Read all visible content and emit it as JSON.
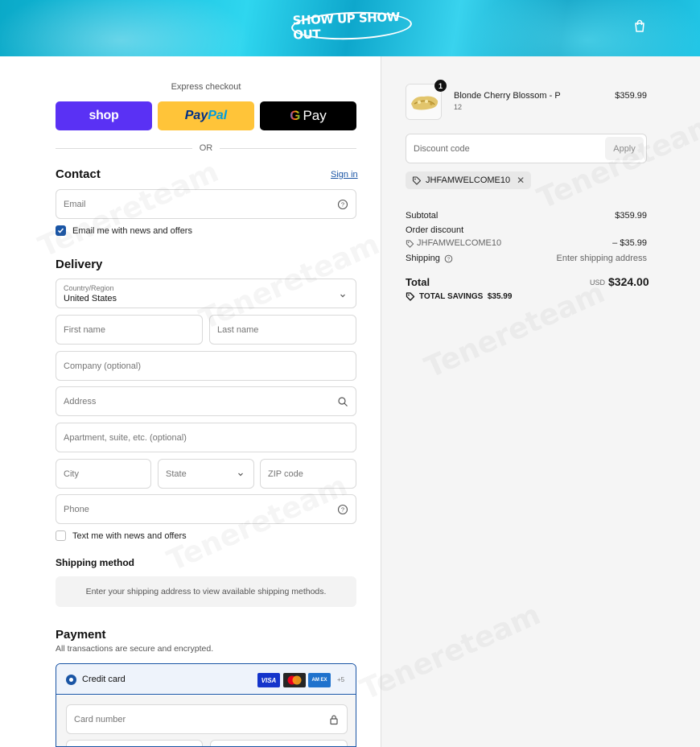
{
  "header": {
    "logo_text": "SHOW UP SHOW OUT",
    "bag_icon": "shopping-bag-icon",
    "colors": {
      "banner": "#19c1e0"
    }
  },
  "express": {
    "label": "Express checkout",
    "buttons": {
      "shop": "shop",
      "paypal_1": "Pay",
      "paypal_2": "Pal",
      "gpay_g": "G",
      "gpay_text": "Pay"
    },
    "or": "OR"
  },
  "contact": {
    "heading": "Contact",
    "signin": "Sign in",
    "email_placeholder": "Email",
    "email_news": "Email me with news and offers"
  },
  "delivery": {
    "heading": "Delivery",
    "country_label": "Country/Region",
    "country_value": "United States",
    "first_name": "First name",
    "last_name": "Last name",
    "company": "Company (optional)",
    "address": "Address",
    "apartment": "Apartment, suite, etc. (optional)",
    "city": "City",
    "state": "State",
    "zip": "ZIP code",
    "phone": "Phone",
    "text_news": "Text me with news and offers"
  },
  "shipping": {
    "heading": "Shipping method",
    "message": "Enter your shipping address to view available shipping methods."
  },
  "payment": {
    "heading": "Payment",
    "subtitle": "All transactions are secure and encrypted.",
    "method": "Credit card",
    "cards": {
      "visa": "VISA",
      "amex": "AM EX",
      "more": "+5"
    },
    "card_number": "Card number"
  },
  "summary": {
    "item": {
      "name": "Blonde Cherry Blossom - P",
      "variant": "12",
      "price": "$359.99",
      "qty": "1"
    },
    "discount_placeholder": "Discount code",
    "apply": "Apply",
    "code_tag": "JHFAMWELCOME10",
    "subtotal_label": "Subtotal",
    "subtotal": "$359.99",
    "order_discount_label": "Order discount",
    "discount_code": "JHFAMWELCOME10",
    "discount_value": "– $35.99",
    "shipping_label": "Shipping",
    "shipping_value": "Enter shipping address",
    "total_label": "Total",
    "currency": "USD",
    "total": "$324.00",
    "savings": "TOTAL SAVINGS  $35.99"
  },
  "watermark": "Tenereteam"
}
